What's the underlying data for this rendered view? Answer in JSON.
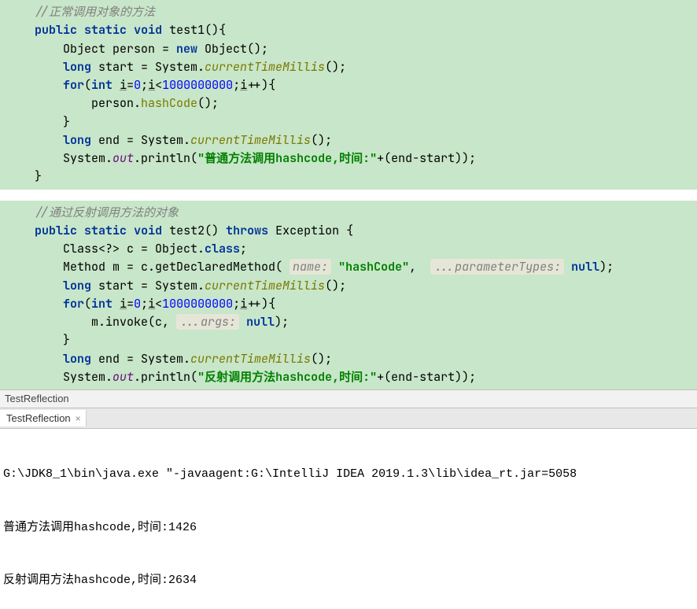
{
  "block1": {
    "comment": "//正常调用对象的方法",
    "sig_public": "public",
    "sig_static": "static",
    "sig_void": "void",
    "sig_name": "test1(){",
    "l1_a": "Object person = ",
    "l1_new": "new",
    "l1_b": " Object();",
    "l2_type": "long",
    "l2_a": " start = System.",
    "l2_m": "currentTimeMillis",
    "l2_b": "();",
    "l3_for": "for",
    "l3_a": "(",
    "l3_int": "int",
    "l3_b": " ",
    "l3_i": "i",
    "l3_c": "=",
    "l3_zero": "0",
    "l3_d": ";",
    "l3_i2": "i",
    "l3_e": "<",
    "l3_num": "1000000000",
    "l3_f": ";",
    "l3_i3": "i",
    "l3_g": "++){",
    "l4_a": "person.",
    "l4_m": "hashCode",
    "l4_b": "();",
    "l5": "}",
    "l6_type": "long",
    "l6_a": " end = System.",
    "l6_m": "currentTimeMillis",
    "l6_b": "();",
    "l7_a": "System.",
    "l7_out": "out",
    "l7_b": ".println(",
    "l7_str": "\"普通方法调用hashcode,时间:\"",
    "l7_c": "+(end-start));",
    "l8": "}"
  },
  "block2": {
    "comment": "//通过反射调用方法的对象",
    "sig_public": "public",
    "sig_static": "static",
    "sig_void": "void",
    "sig_name": "test2() ",
    "sig_throws": "throws",
    "sig_ex": " Exception {",
    "l1_a": "Class<?> c = Object.",
    "l1_class": "class",
    "l1_b": ";",
    "l2_a": "Method m = c.getDeclaredMethod( ",
    "l2_hint1": "name:",
    "l2_str": "\"hashCode\"",
    "l2_b": ", ",
    "l2_hint2": "...parameterTypes:",
    "l2_null": "null",
    "l2_c": ");",
    "l3_type": "long",
    "l3_a": " start = System.",
    "l3_m": "currentTimeMillis",
    "l3_b": "();",
    "l4_for": "for",
    "l4_a": "(",
    "l4_int": "int",
    "l4_b": " ",
    "l4_i": "i",
    "l4_c": "=",
    "l4_zero": "0",
    "l4_d": ";",
    "l4_i2": "i",
    "l4_e": "<",
    "l4_num": "1000000000",
    "l4_f": ";",
    "l4_i3": "i",
    "l4_g": "++){",
    "l5_a": "m.invoke(c, ",
    "l5_hint": "...args:",
    "l5_null": "null",
    "l5_b": ");",
    "l6": "}",
    "l7_type": "long",
    "l7_a": " end = System.",
    "l7_m": "currentTimeMillis",
    "l7_b": "();",
    "l8_a": "System.",
    "l8_out": "out",
    "l8_b": ".println(",
    "l8_str": "\"反射调用方法hashcode,时间:\"",
    "l8_c": "+(end-start));"
  },
  "run": {
    "header": "TestReflection",
    "tab": "TestReflection",
    "cmd": "G:\\JDK8_1\\bin\\java.exe \"-javaagent:G:\\IntelliJ IDEA 2019.1.3\\lib\\idea_rt.jar=5058",
    "out1": "普通方法调用hashcode,时间:1426",
    "out2": "反射调用方法hashcode,时间:2634"
  }
}
